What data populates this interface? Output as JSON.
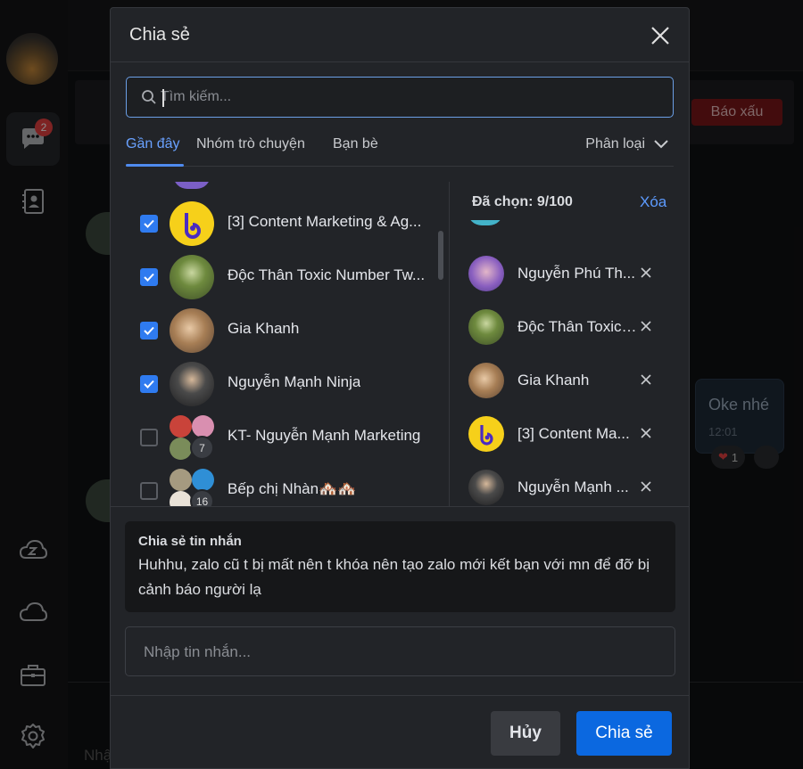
{
  "background": {
    "report_button": "Báo xấu",
    "bubble_text": "Oke nhé",
    "bubble_time": "12:01",
    "reaction_count": "1",
    "input_placeholder": "Nhập",
    "nav_badge": "2"
  },
  "dialog": {
    "title": "Chia sẻ",
    "search_placeholder": "Tìm kiếm...",
    "tabs": [
      "Gần đây",
      "Nhóm trò chuyện",
      "Bạn bè"
    ],
    "sort_label": "Phân loại",
    "contacts": [
      {
        "name": "[3] Content Marketing & Ag...",
        "checked": true
      },
      {
        "name": "Độc Thân Toxic Number Tw...",
        "checked": true
      },
      {
        "name": "Gia Khanh",
        "checked": true
      },
      {
        "name": "Nguyễn Mạnh Ninja",
        "checked": true
      },
      {
        "name": "KT- Nguyễn Mạnh Marketing",
        "checked": false,
        "member_count": "7"
      },
      {
        "name": "Bếp chị Nhàn🏘️🏘️",
        "checked": false,
        "member_count": "16"
      }
    ],
    "selected_header": "Đã chọn: 9/100",
    "clear_label": "Xóa",
    "selected": [
      {
        "name": "Nguyễn Phú Th..."
      },
      {
        "name": "Độc Thân Toxic ..."
      },
      {
        "name": "Gia Khanh"
      },
      {
        "name": "[3] Content Ma..."
      },
      {
        "name": "Nguyễn Mạnh ..."
      }
    ],
    "quote_title": "Chia sẻ tin nhắn",
    "quote_text": "Huhhu, zalo cũ t bị mất nên t khóa nên tạo zalo mới kết bạn với mn để đỡ bị cảnh báo người lạ",
    "message_placeholder": "Nhập tin nhắn...",
    "cancel_label": "Hủy",
    "share_label": "Chia sẻ"
  },
  "colors": {
    "accent": "#2f7bf0",
    "share_button": "#0b68e0",
    "report_button": "#7a1619"
  }
}
